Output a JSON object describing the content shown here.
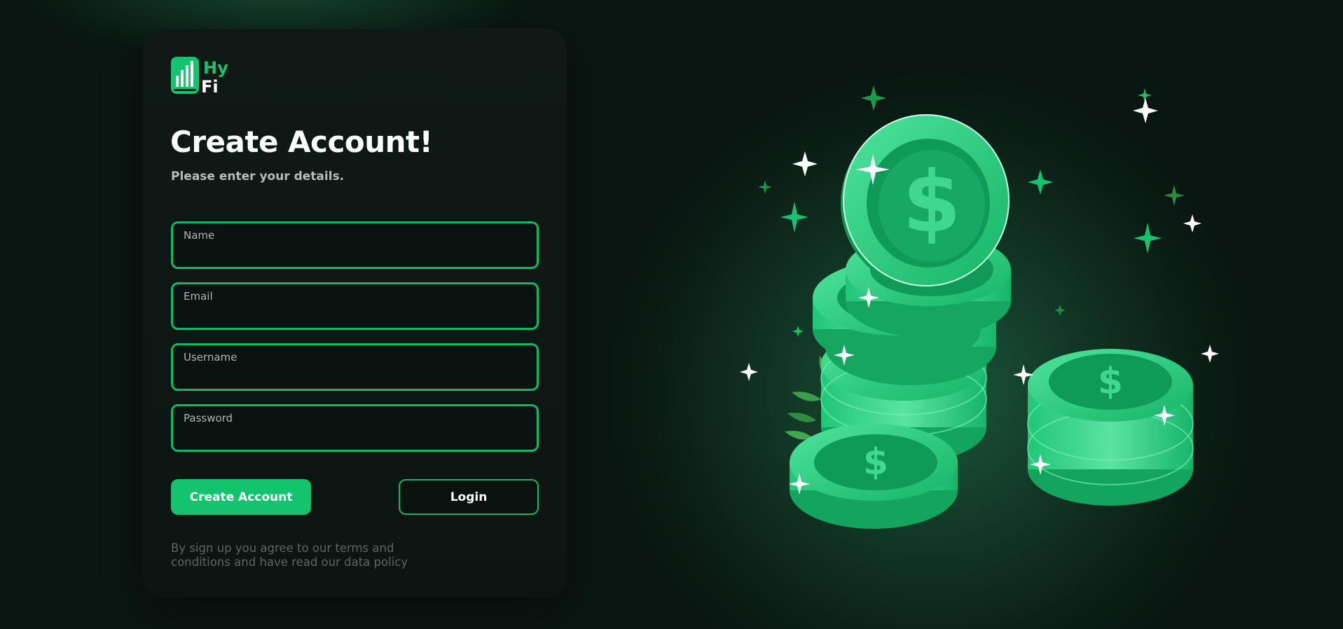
{
  "brand": {
    "logo_line1": "Hy",
    "logo_line2": "Fi",
    "accent_color": "#13c46f",
    "icon": "bar-chart-icon"
  },
  "form": {
    "title": "Create Account!",
    "subtitle": "Please enter your details.",
    "fields": [
      {
        "label": "Name",
        "value": ""
      },
      {
        "label": "Email",
        "value": ""
      },
      {
        "label": "Username",
        "value": ""
      },
      {
        "label": "Password",
        "value": ""
      }
    ],
    "create_button": "Create Account",
    "login_button": "Login",
    "terms": "By sign up you agree to our terms and conditions and have read our data policy"
  },
  "illustration": {
    "subject": "stacked-dollar-coins-icon",
    "colors": {
      "coin_light": "#3fd88e",
      "coin_mid": "#1fbf72",
      "coin_dark": "#0e9a57"
    }
  }
}
